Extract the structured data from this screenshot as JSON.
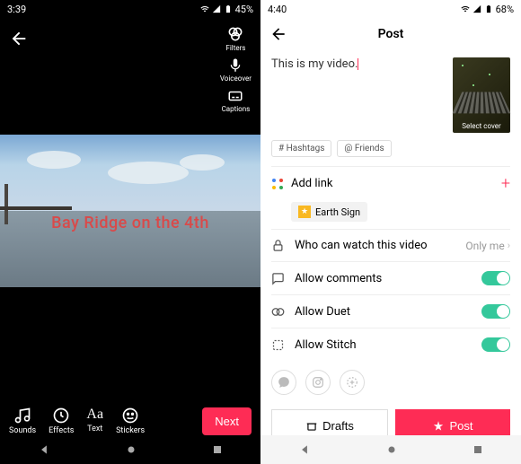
{
  "colors": {
    "accent": "#fe2c55",
    "toggle_on": "#34c89b",
    "overlay_red": "#d94a4a"
  },
  "left": {
    "status": {
      "time": "3:39",
      "battery": "45%"
    },
    "side_tools": {
      "filters": "Filters",
      "voiceover": "Voiceover",
      "captions": "Captions"
    },
    "overlay_text": "Bay Ridge on the 4th",
    "bottom_tools": {
      "sounds": "Sounds",
      "effects": "Effects",
      "text": "Text",
      "stickers": "Stickers"
    },
    "next": "Next"
  },
  "right": {
    "status": {
      "time": "4:40",
      "battery": "68%"
    },
    "title": "Post",
    "caption": "This is my video.",
    "cover_label": "Select cover",
    "chips": {
      "hashtags": "# Hashtags",
      "friends": "@ Friends"
    },
    "link": {
      "label": "Add link",
      "attached": "Earth Sign"
    },
    "privacy": {
      "label": "Who can watch this video",
      "value": "Only me"
    },
    "comments": {
      "label": "Allow comments",
      "on": true
    },
    "duet": {
      "label": "Allow Duet",
      "on": true
    },
    "stitch": {
      "label": "Allow Stitch",
      "on": true
    },
    "drafts": "Drafts",
    "post": "Post"
  }
}
